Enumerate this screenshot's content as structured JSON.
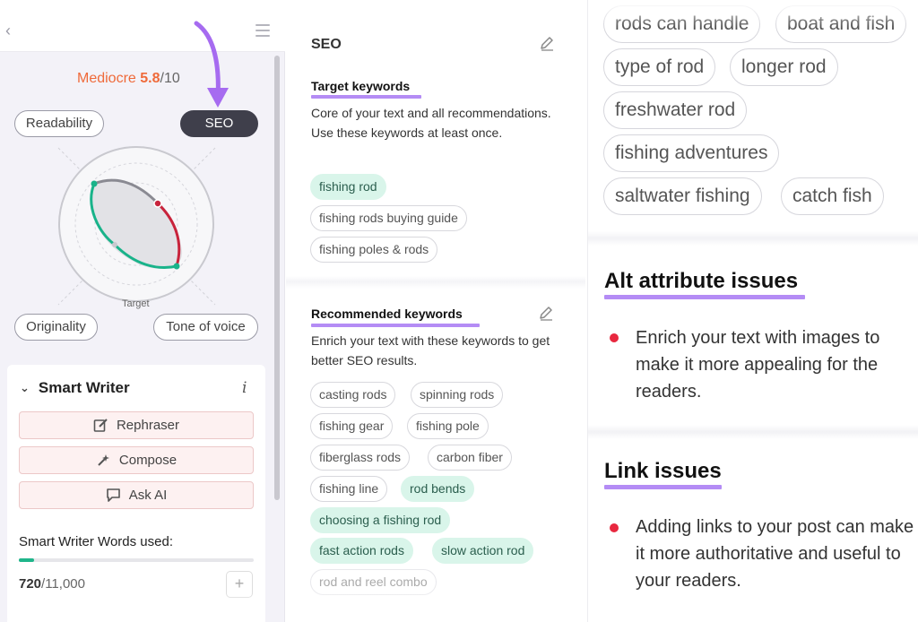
{
  "left_panel": {
    "score_label": "Mediocre",
    "score_value": "5.8",
    "score_max": "/10",
    "tabs": {
      "readability": "Readability",
      "seo": "SEO",
      "originality": "Originality",
      "tone": "Tone of voice"
    },
    "radar_target_label": "Target",
    "smart_writer": {
      "title": "Smart Writer",
      "buttons": {
        "rephraser": "Rephraser",
        "compose": "Compose",
        "ask_ai": "Ask AI"
      },
      "words_label": "Smart Writer Words used:",
      "words_used": "720",
      "words_total": "/11,000",
      "words_fraction": 0.065
    }
  },
  "middle_panel": {
    "heading": "SEO",
    "target_keywords": {
      "title": "Target keywords",
      "description": "Core of your text and all recommendations. Use these keywords at least once.",
      "chips": [
        "fishing rod",
        "fishing rods buying guide",
        "fishing poles & rods"
      ]
    },
    "recommended_keywords": {
      "title": "Recommended keywords",
      "description": "Enrich your text with these keywords to get better SEO results.",
      "chips": [
        "casting rods",
        "spinning rods",
        "fishing gear",
        "fishing pole",
        "fiberglass rods",
        "carbon fiber",
        "fishing line",
        "rod bends",
        "choosing a fishing rod",
        "fast action rods",
        "slow action rod",
        "rod and reel combo"
      ]
    }
  },
  "right_panel": {
    "keywords": [
      "rods can handle",
      "boat and fish",
      "type of rod",
      "longer rod",
      "freshwater rod",
      "fishing adventures",
      "saltwater fishing",
      "catch fish"
    ],
    "alt_issues": {
      "title": "Alt attribute issues",
      "text": "Enrich your text with images to make it more appealing for the readers."
    },
    "link_issues": {
      "title": "Link issues",
      "text": "Adding links to your post can make it more authoritative and useful to your readers."
    }
  },
  "colors": {
    "accent_purple": "#b48cf5",
    "score_orange": "#ef6a3a",
    "green_chip": "#d9f5ea",
    "bullet_red": "#e8283f"
  }
}
